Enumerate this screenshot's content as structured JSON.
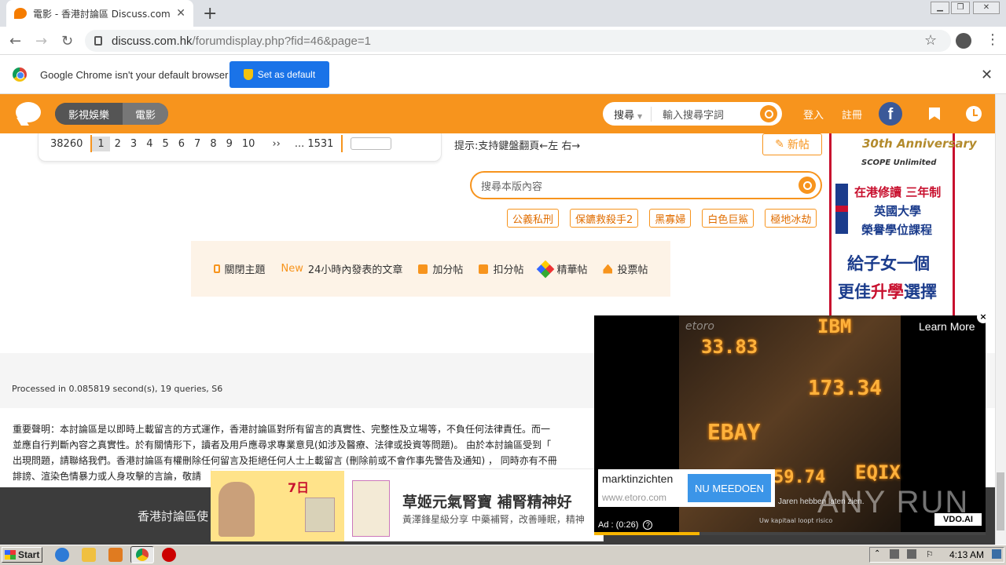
{
  "browser": {
    "tab_title": "電影 - 香港討論區 Discuss.com.hk -",
    "tab_close": "✕",
    "new_tab": "+",
    "url_host": "discuss.com.hk",
    "url_path": "/forumdisplay.php?fid=46&page=1",
    "win_minimize": "▁",
    "win_restore": "❐",
    "win_close": "✕"
  },
  "infobar": {
    "message": "Google Chrome isn't your default browser",
    "button": "Set as default",
    "close": "✕"
  },
  "site_header": {
    "category_1": "影視娛樂",
    "category_2": "電影",
    "search_type": "搜尋",
    "search_placeholder": "輸入搜尋字詞",
    "login": "登入",
    "register": "註冊",
    "facebook": "f"
  },
  "pager": {
    "total": "38260",
    "pages": [
      "1",
      "2",
      "3",
      "4",
      "5",
      "6",
      "7",
      "8",
      "9",
      "10"
    ],
    "current": "1",
    "next": "››",
    "last": "... 1531",
    "hint": "提示:支持鍵盤翻頁←左 右→",
    "new_post": "新帖"
  },
  "forum_search": {
    "placeholder": "搜尋本版內容"
  },
  "tags": [
    "公義私刑",
    "保鑣救殺手2",
    "黑寡婦",
    "白色巨鯊",
    "極地冰劫"
  ],
  "filters": {
    "close_topic": "關閉主題",
    "new_badge": "New",
    "new_24h": "24小時內發表的文章",
    "plus": "加分帖",
    "minus": "扣分帖",
    "digest": "精華帖",
    "poll": "投票帖"
  },
  "footer": {
    "processed": "Processed in 0.085819 second(s), 19 queries, S6",
    "disclaimer_1": "重要聲明：本討論區是以即時上載留言的方式運作，香港討論區對所有留言的真實性、完整性及立場等，不負任何法律責任。而一",
    "disclaimer_2": "並應自行判斷內容之真實性。於有關情形下，讀者及用戶應尋求專業意見(如涉及醫療、法律或投資等問題)。 由於本討論區受到「",
    "disclaimer_3": "出現問題，請聯絡我們。香港討論區有權刪除任何留言及拒絕任何人士上載留言 (刪除前或不會作事先警告及通知) ， 同時亦有不冊",
    "disclaimer_4": "誹謗、渲染色情暴力或人身攻擊的言論，敬請",
    "dark_text": "香港討論區使"
  },
  "side_ad": {
    "anniv": "30th Anniversary",
    "anniv_sub": "SCOPE Unlimited",
    "line1": "在港修讀 三年制",
    "line2": "英國大學",
    "line3": "榮譽學位課程",
    "line4": "給子女一個",
    "line5a": "更佳",
    "line5b": "升學",
    "line5c": "選擇"
  },
  "banner_ad": {
    "badge": "7日",
    "title": "草姬元氣腎寶 補腎精神好",
    "subtitle": "黃澤鋒星級分享 中藥補腎，改善睡眠，精神"
  },
  "video_ad": {
    "brand": "etoro",
    "learn_more": "Learn More",
    "close": "×",
    "advertiser": "marktinzichten",
    "advertiser_url": "www.etoro.com",
    "cta": "NU MEEDOEN",
    "caption": "Jaren hebben laten zien.",
    "small_print": "Uw kapitaal loopt risico",
    "timer": "Ad : (0:26)",
    "help": "?",
    "vdo": "VDO.AI",
    "progress": 0.27,
    "tickers": [
      "33.83",
      "IBM",
      "173.34",
      "EBAY",
      "EQIX",
      "59.74"
    ],
    "watermark": "ANY RUN"
  },
  "taskbar": {
    "start": "Start",
    "clock": "4:13 AM"
  }
}
